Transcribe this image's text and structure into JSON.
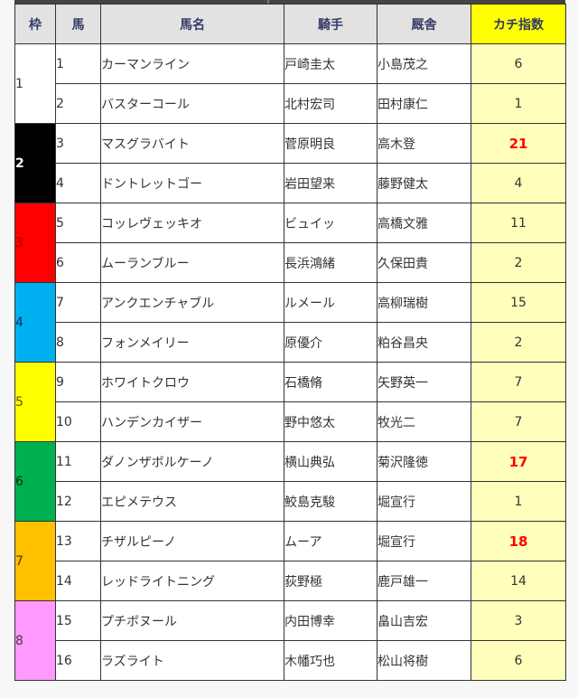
{
  "table": {
    "headers": {
      "waku": "枠",
      "umaban": "馬",
      "horse_name": "馬名",
      "jockey": "騎手",
      "trainer": "厩舎",
      "index": "カチ指数"
    },
    "colors": {
      "index_header_bg": "#ffff00",
      "index_cell_bg": "#ffffbb",
      "highlight_text": "#ff0000"
    },
    "waku_colors": {
      "1": "#ffffff",
      "2": "#000000",
      "3": "#ff0000",
      "4": "#00b0f0",
      "5": "#ffff00",
      "6": "#00b050",
      "7": "#ffc000",
      "8": "#ff99ff"
    },
    "rows": [
      {
        "waku": "1",
        "umaban": "1",
        "horse": "カーマンライン",
        "jockey": "戸崎圭太",
        "trainer": "小島茂之",
        "index": "6",
        "highlight": false
      },
      {
        "waku": "1",
        "umaban": "2",
        "horse": "バスターコール",
        "jockey": "北村宏司",
        "trainer": "田村康仁",
        "index": "1",
        "highlight": false
      },
      {
        "waku": "2",
        "umaban": "3",
        "horse": "マスグラバイト",
        "jockey": "菅原明良",
        "trainer": "高木登",
        "index": "21",
        "highlight": true
      },
      {
        "waku": "2",
        "umaban": "4",
        "horse": "ドントレットゴー",
        "jockey": "岩田望来",
        "trainer": "藤野健太",
        "index": "4",
        "highlight": false
      },
      {
        "waku": "3",
        "umaban": "5",
        "horse": "コッレヴェッキオ",
        "jockey": "ビュイッ",
        "trainer": "高橋文雅",
        "index": "11",
        "highlight": false
      },
      {
        "waku": "3",
        "umaban": "6",
        "horse": "ムーランブルー",
        "jockey": "長浜鴻緒",
        "trainer": "久保田貴",
        "index": "2",
        "highlight": false
      },
      {
        "waku": "4",
        "umaban": "7",
        "horse": "アンクエンチャブル",
        "jockey": "ルメール",
        "trainer": "高柳瑞樹",
        "index": "15",
        "highlight": false
      },
      {
        "waku": "4",
        "umaban": "8",
        "horse": "フォンメイリー",
        "jockey": "原優介",
        "trainer": "粕谷昌央",
        "index": "2",
        "highlight": false
      },
      {
        "waku": "5",
        "umaban": "9",
        "horse": "ホワイトクロウ",
        "jockey": "石橋脩",
        "trainer": "矢野英一",
        "index": "7",
        "highlight": false
      },
      {
        "waku": "5",
        "umaban": "10",
        "horse": "ハンデンカイザー",
        "jockey": "野中悠太",
        "trainer": "牧光二",
        "index": "7",
        "highlight": false
      },
      {
        "waku": "6",
        "umaban": "11",
        "horse": "ダノンザボルケーノ",
        "jockey": "横山典弘",
        "trainer": "菊沢隆徳",
        "index": "17",
        "highlight": true
      },
      {
        "waku": "6",
        "umaban": "12",
        "horse": "エピメテウス",
        "jockey": "鮫島克駿",
        "trainer": "堀宣行",
        "index": "1",
        "highlight": false
      },
      {
        "waku": "7",
        "umaban": "13",
        "horse": "チザルピーノ",
        "jockey": "ムーア",
        "trainer": "堀宣行",
        "index": "18",
        "highlight": true
      },
      {
        "waku": "7",
        "umaban": "14",
        "horse": "レッドライトニング",
        "jockey": "荻野極",
        "trainer": "鹿戸雄一",
        "index": "14",
        "highlight": false
      },
      {
        "waku": "8",
        "umaban": "15",
        "horse": "プチボヌール",
        "jockey": "内田博幸",
        "trainer": "畠山吉宏",
        "index": "3",
        "highlight": false
      },
      {
        "waku": "8",
        "umaban": "16",
        "horse": "ラズライト",
        "jockey": "木幡巧也",
        "trainer": "松山将樹",
        "index": "6",
        "highlight": false
      }
    ]
  }
}
